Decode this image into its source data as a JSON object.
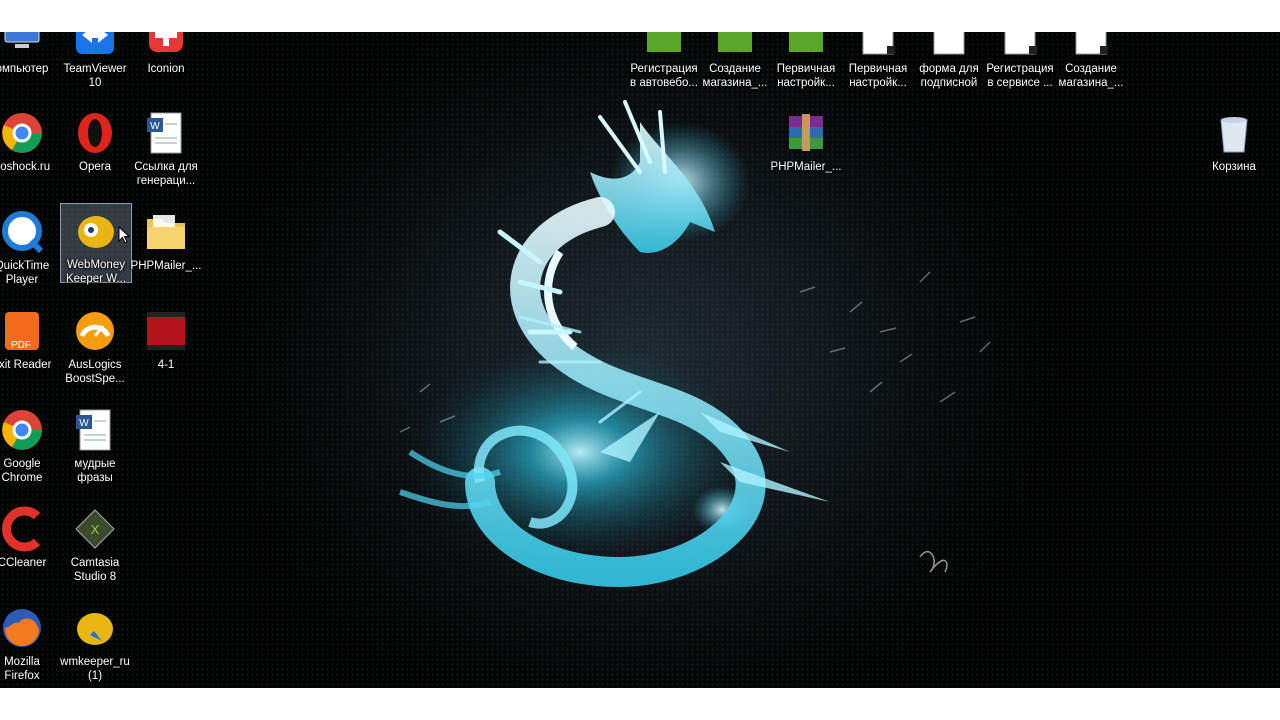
{
  "desktop": {
    "left_icons": [
      {
        "id": "computer",
        "label1": "омпьютер",
        "label2": ""
      },
      {
        "id": "teamviewer",
        "label1": "TeamViewer",
        "label2": "10"
      },
      {
        "id": "iconion",
        "label1": "Iconion",
        "label2": ""
      },
      {
        "id": "chrome1",
        "label1": "ooshock.ru",
        "label2": ""
      },
      {
        "id": "opera",
        "label1": "Opera",
        "label2": ""
      },
      {
        "id": "word-link",
        "label1": "Ссылка для",
        "label2": "генераци..."
      },
      {
        "id": "quicktime",
        "label1": "QuickTime",
        "label2": "Player"
      },
      {
        "id": "webmoney",
        "label1": "WebMoney",
        "label2": "Keeper W..."
      },
      {
        "id": "phpmailer-folder",
        "label1": "PHPMailer_...",
        "label2": ""
      },
      {
        "id": "foxit",
        "label1": "oxit Reader",
        "label2": ""
      },
      {
        "id": "auslogics",
        "label1": "AusLogics",
        "label2": "BoostSpe..."
      },
      {
        "id": "video41",
        "label1": "4-1",
        "label2": ""
      },
      {
        "id": "chrome2",
        "label1": "Google",
        "label2": "Chrome"
      },
      {
        "id": "word-phrases",
        "label1": "мудрые",
        "label2": "фразы"
      },
      {
        "id": "ccleaner",
        "label1": "CCleaner",
        "label2": ""
      },
      {
        "id": "camtasia",
        "label1": "Camtasia",
        "label2": "Studio 8"
      },
      {
        "id": "firefox",
        "label1": "Mozilla",
        "label2": "Firefox"
      },
      {
        "id": "wmkeeper",
        "label1": "wmkeeper_ru",
        "label2": "(1)"
      }
    ],
    "top_icons": [
      {
        "id": "reg1",
        "label1": "Регистрация",
        "label2": "в автовебо..."
      },
      {
        "id": "create1",
        "label1": "Создание",
        "label2": "магазина_..."
      },
      {
        "id": "prim1",
        "label1": "Первичная",
        "label2": "настройк..."
      },
      {
        "id": "prim2",
        "label1": "Первичная",
        "label2": "настройк..."
      },
      {
        "id": "form",
        "label1": "форма для",
        "label2": "подписной"
      },
      {
        "id": "reg2",
        "label1": "Регистрация",
        "label2": "в сервисе ..."
      },
      {
        "id": "create2",
        "label1": "Создание",
        "label2": "магазина_..."
      }
    ],
    "phpmailer_rar": {
      "label1": "PHPMailer_...",
      "label2": ""
    },
    "recycle_bin": {
      "label1": "Корзина",
      "label2": ""
    }
  }
}
